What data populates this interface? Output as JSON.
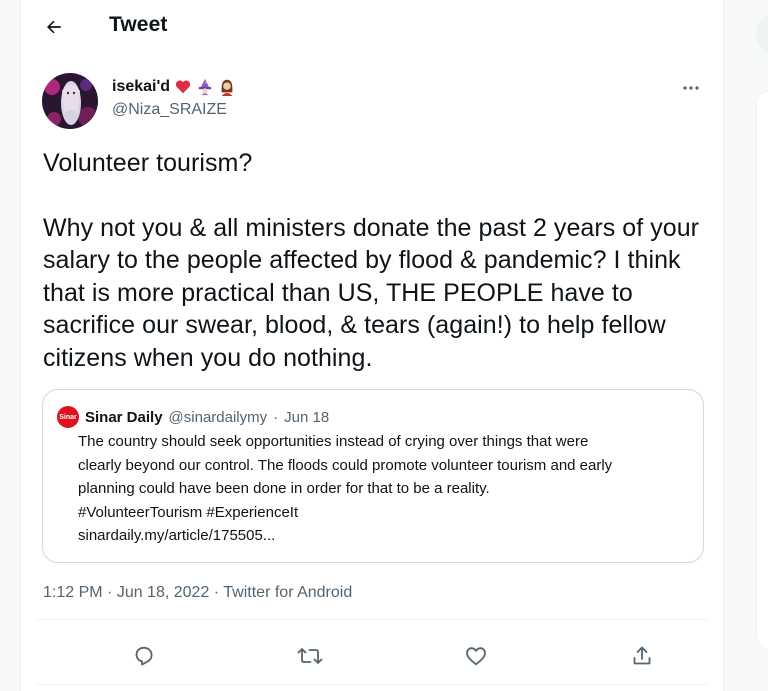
{
  "header": {
    "title": "Tweet",
    "back_icon": "arrow-left-icon"
  },
  "author": {
    "name": "isekai'd",
    "handle": "@Niza_SRAIZE",
    "name_emojis": [
      "red-heart-emoji",
      "wizard-emoji",
      "woman-emoji"
    ],
    "more_icon": "ellipsis-icon"
  },
  "tweet": {
    "paragraphs": [
      "Volunteer tourism?",
      "Why not you & all ministers donate the past 2 years of your salary to the people affected by flood & pandemic? I think that is more practical than US, THE PEOPLE have to sacrifice our swear, blood, & tears (again!) to help fellow citizens when you do nothing."
    ]
  },
  "quote": {
    "avatar_text": "Sinar",
    "name": "Sinar Daily",
    "handle": "@sinardailymy",
    "separator": "·",
    "date": "Jun 18",
    "text_lines": [
      "The country should seek opportunities instead of crying over things that were",
      "clearly beyond our control. The floods could promote volunteer tourism and early",
      "planning could have been done in order for that to be a reality.",
      "#VolunteerTourism #ExperienceIt",
      "sinardaily.my/article/175505..."
    ]
  },
  "meta": {
    "time": "1:12 PM",
    "separator": " · ",
    "date": "Jun 18, 2022",
    "source": "Twitter for Android"
  },
  "actions": [
    {
      "name": "reply-button",
      "icon": "reply-icon"
    },
    {
      "name": "retweet-button",
      "icon": "retweet-icon"
    },
    {
      "name": "like-button",
      "icon": "heart-icon"
    },
    {
      "name": "share-button",
      "icon": "share-icon"
    }
  ],
  "colors": {
    "text": "#0f1419",
    "secondary": "#536471",
    "border": "#cfd9de",
    "divider": "#eff3f4",
    "heart": "#f91880",
    "sinar_red": "#e0111f"
  }
}
